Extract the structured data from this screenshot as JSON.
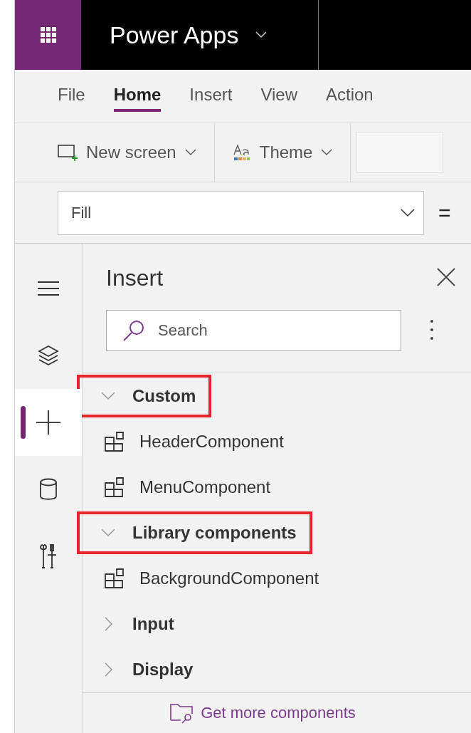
{
  "app_title": "Power Apps",
  "menu_tabs": [
    {
      "label": "File",
      "selected": false
    },
    {
      "label": "Home",
      "selected": true
    },
    {
      "label": "Insert",
      "selected": false
    },
    {
      "label": "View",
      "selected": false
    },
    {
      "label": "Action",
      "selected": false
    }
  ],
  "toolbar": [
    {
      "kind": "new-screen",
      "label": "New screen"
    },
    {
      "kind": "theme",
      "label": "Theme"
    }
  ],
  "formula_bar": {
    "property": "Fill",
    "operator": "="
  },
  "rail": [
    {
      "kind": "menu",
      "selected": false
    },
    {
      "kind": "layers",
      "selected": false
    },
    {
      "kind": "insert",
      "selected": true
    },
    {
      "kind": "data",
      "selected": false
    },
    {
      "kind": "tools",
      "selected": false
    }
  ],
  "panel": {
    "title": "Insert",
    "search": {
      "placeholder": "Search"
    },
    "sections": [
      {
        "label": "Custom",
        "expanded": true,
        "highlighted": true,
        "children": [
          {
            "label": "HeaderComponent"
          },
          {
            "label": "MenuComponent"
          }
        ]
      },
      {
        "label": "Library components",
        "expanded": true,
        "highlighted": true,
        "children": [
          {
            "label": "BackgroundComponent"
          }
        ]
      },
      {
        "label": "Input",
        "expanded": false,
        "highlighted": false
      },
      {
        "label": "Display",
        "expanded": false,
        "highlighted": false
      }
    ],
    "footer_link": "Get more components"
  }
}
